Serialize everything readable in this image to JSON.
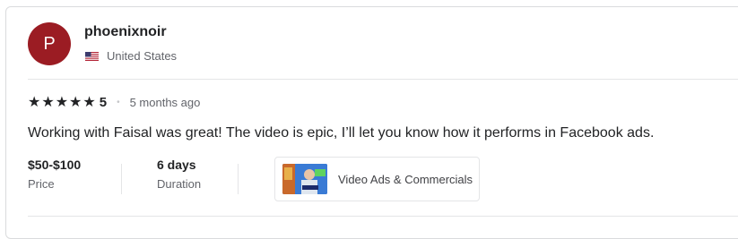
{
  "reviewer": {
    "avatar_initial": "P",
    "avatar_color": "#9b1c23",
    "username": "phoenixnoir",
    "country": "United States",
    "flag_icon": "us-flag-icon"
  },
  "review": {
    "star_icon": "star-icon",
    "star_count": 5,
    "rating": "5",
    "separator": "•",
    "time_ago": "5 months ago",
    "text": "Working with Faisal was great! The video is epic, I’ll let you know how it performs in Facebook ads."
  },
  "details": {
    "price_value": "$50-$100",
    "price_label": "Price",
    "duration_value": "6 days",
    "duration_label": "Duration"
  },
  "gig": {
    "title": "Video Ads & Commercials",
    "thumbnail_icon": "gig-thumbnail-image"
  },
  "colors": {
    "text_primary": "#222325",
    "text_secondary": "#62646a",
    "border": "#e4e5e7"
  }
}
